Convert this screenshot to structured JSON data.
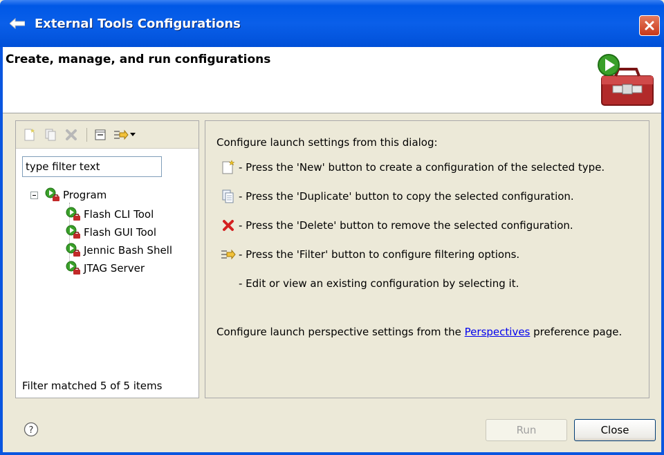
{
  "window": {
    "title": "External Tools Configurations"
  },
  "banner": {
    "title": "Create, manage, and run configurations"
  },
  "left": {
    "filter_placeholder": "type filter text",
    "filter_value": "type filter text",
    "tree": {
      "root": "Program",
      "children": [
        "Flash CLI Tool",
        "Flash GUI Tool",
        "Jennic Bash Shell",
        "JTAG Server"
      ]
    },
    "status": "Filter matched 5 of 5 items"
  },
  "right": {
    "intro": "Configure launch settings from this dialog:",
    "items": [
      {
        "icon": "new-config-icon",
        "text": "- Press the 'New' button to create a configuration of the selected type."
      },
      {
        "icon": "duplicate-icon",
        "text": "- Press the 'Duplicate' button to copy the selected configuration."
      },
      {
        "icon": "delete-icon",
        "text": "- Press the 'Delete' button to remove the selected configuration."
      },
      {
        "icon": "filter-icon",
        "text": "- Press the 'Filter' button to configure filtering options."
      },
      {
        "icon": "",
        "text": "- Edit or view an existing configuration by selecting it."
      }
    ],
    "perspective_prefix": "Configure launch perspective settings from the ",
    "perspective_link": "Perspectives",
    "perspective_suffix": " preference page."
  },
  "buttons": {
    "run": "Run",
    "close": "Close"
  },
  "colors": {
    "titlebar": "#0058e6",
    "dialog_bg": "#ece9d8",
    "link": "#0000ee",
    "close_button": "#c8381a"
  }
}
